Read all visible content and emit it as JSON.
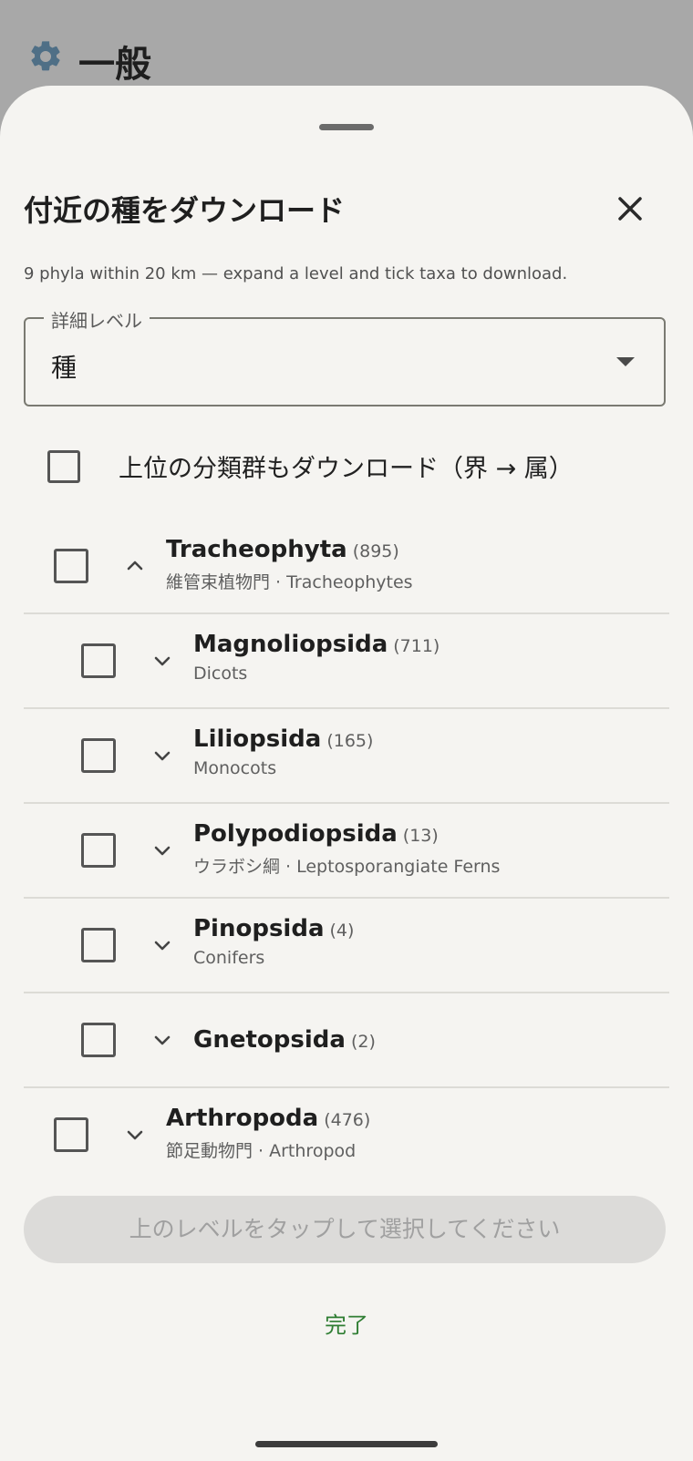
{
  "background": {
    "header_title": "一般",
    "header_icon": "gear-icon"
  },
  "sheet": {
    "title": "付近の種をダウンロード",
    "summary": "9 phyla within 20 km — expand a level and tick taxa to download.",
    "detail_level": {
      "label": "詳細レベル",
      "value": "種"
    },
    "include_higher": {
      "label": "上位の分類群もダウンロード（界 → 属）",
      "checked": false
    },
    "taxa": [
      {
        "name": "Tracheophyta",
        "count": "(895)",
        "sub": "維管束植物門 · Tracheophytes",
        "depth": 0,
        "expanded": true,
        "checked": false
      },
      {
        "name": "Magnoliopsida",
        "count": "(711)",
        "sub": "Dicots",
        "depth": 1,
        "expanded": false,
        "checked": false
      },
      {
        "name": "Liliopsida",
        "count": "(165)",
        "sub": "Monocots",
        "depth": 1,
        "expanded": false,
        "checked": false
      },
      {
        "name": "Polypodiopsida",
        "count": "(13)",
        "sub": "ウラボシ綱 · Leptosporangiate Ferns",
        "depth": 1,
        "expanded": false,
        "checked": false
      },
      {
        "name": "Pinopsida",
        "count": "(4)",
        "sub": "Conifers",
        "depth": 1,
        "expanded": false,
        "checked": false
      },
      {
        "name": "Gnetopsida",
        "count": "(2)",
        "sub": "",
        "depth": 1,
        "expanded": false,
        "checked": false
      },
      {
        "name": "Arthropoda",
        "count": "(476)",
        "sub": "節足動物門 · Arthropod",
        "depth": 0,
        "expanded": false,
        "checked": false
      }
    ],
    "select_button_label": "上のレベルをタップして選択してください",
    "done_label": "完了"
  },
  "colors": {
    "accent_green": "#2e7d32",
    "scrim": "#a8a8a8",
    "sheet_bg": "#f5f4f1"
  }
}
